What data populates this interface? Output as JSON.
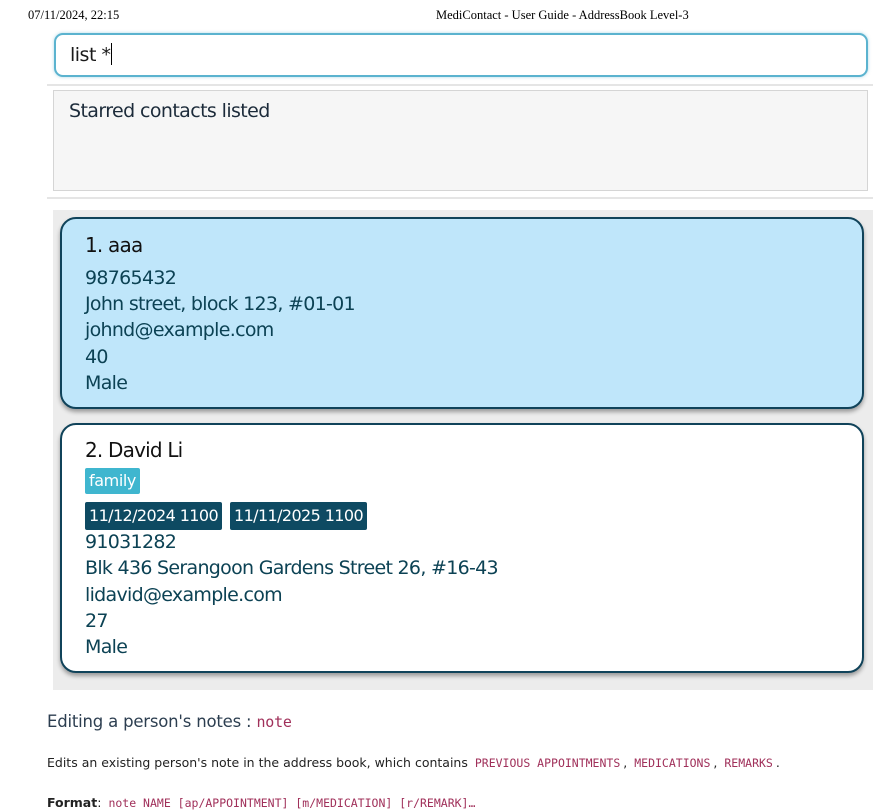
{
  "print_header": {
    "datetime": "07/11/2024, 22:15",
    "title": "MediContact - User Guide - AddressBook Level-3"
  },
  "command_box": {
    "value": "list *"
  },
  "result_display": {
    "text": "Starred contacts listed"
  },
  "persons": [
    {
      "title": "1. aaa",
      "phone": "98765432",
      "address": "John street, block 123, #01-01",
      "email": "johnd@example.com",
      "age": "40",
      "sex": "Male",
      "starred_color": "#bfe6fa"
    },
    {
      "title": "2. David Li",
      "tags": [
        "family"
      ],
      "appointments": [
        "11/12/2024 1100",
        "11/11/2025 1100"
      ],
      "phone": "91031282",
      "address": "Blk 436 Serangoon Gardens Street 26, #16-43",
      "email": "lidavid@example.com",
      "age": "27",
      "sex": "Male"
    }
  ],
  "doc": {
    "heading_text": "Editing a person's notes :",
    "heading_code": "note",
    "para_prefix": "Edits an existing person's note in the address book, which contains",
    "para_code1": "PREVIOUS APPOINTMENTS",
    "para_code2": "MEDICATIONS",
    "para_code3": "REMARKS",
    "sep": ",",
    "period": ".",
    "format_label": "Format",
    "format_colon": ":",
    "format_code": "note NAME [ap/APPOINTMENT] [m/MEDICATION] [r/REMARK]…"
  },
  "colors": {
    "accent_border": "#5bb3cf",
    "card_border": "#10435a",
    "tag_bg": "#3fb6cf",
    "appointment_bg": "#0e4a62",
    "code_text": "#a0305a"
  }
}
